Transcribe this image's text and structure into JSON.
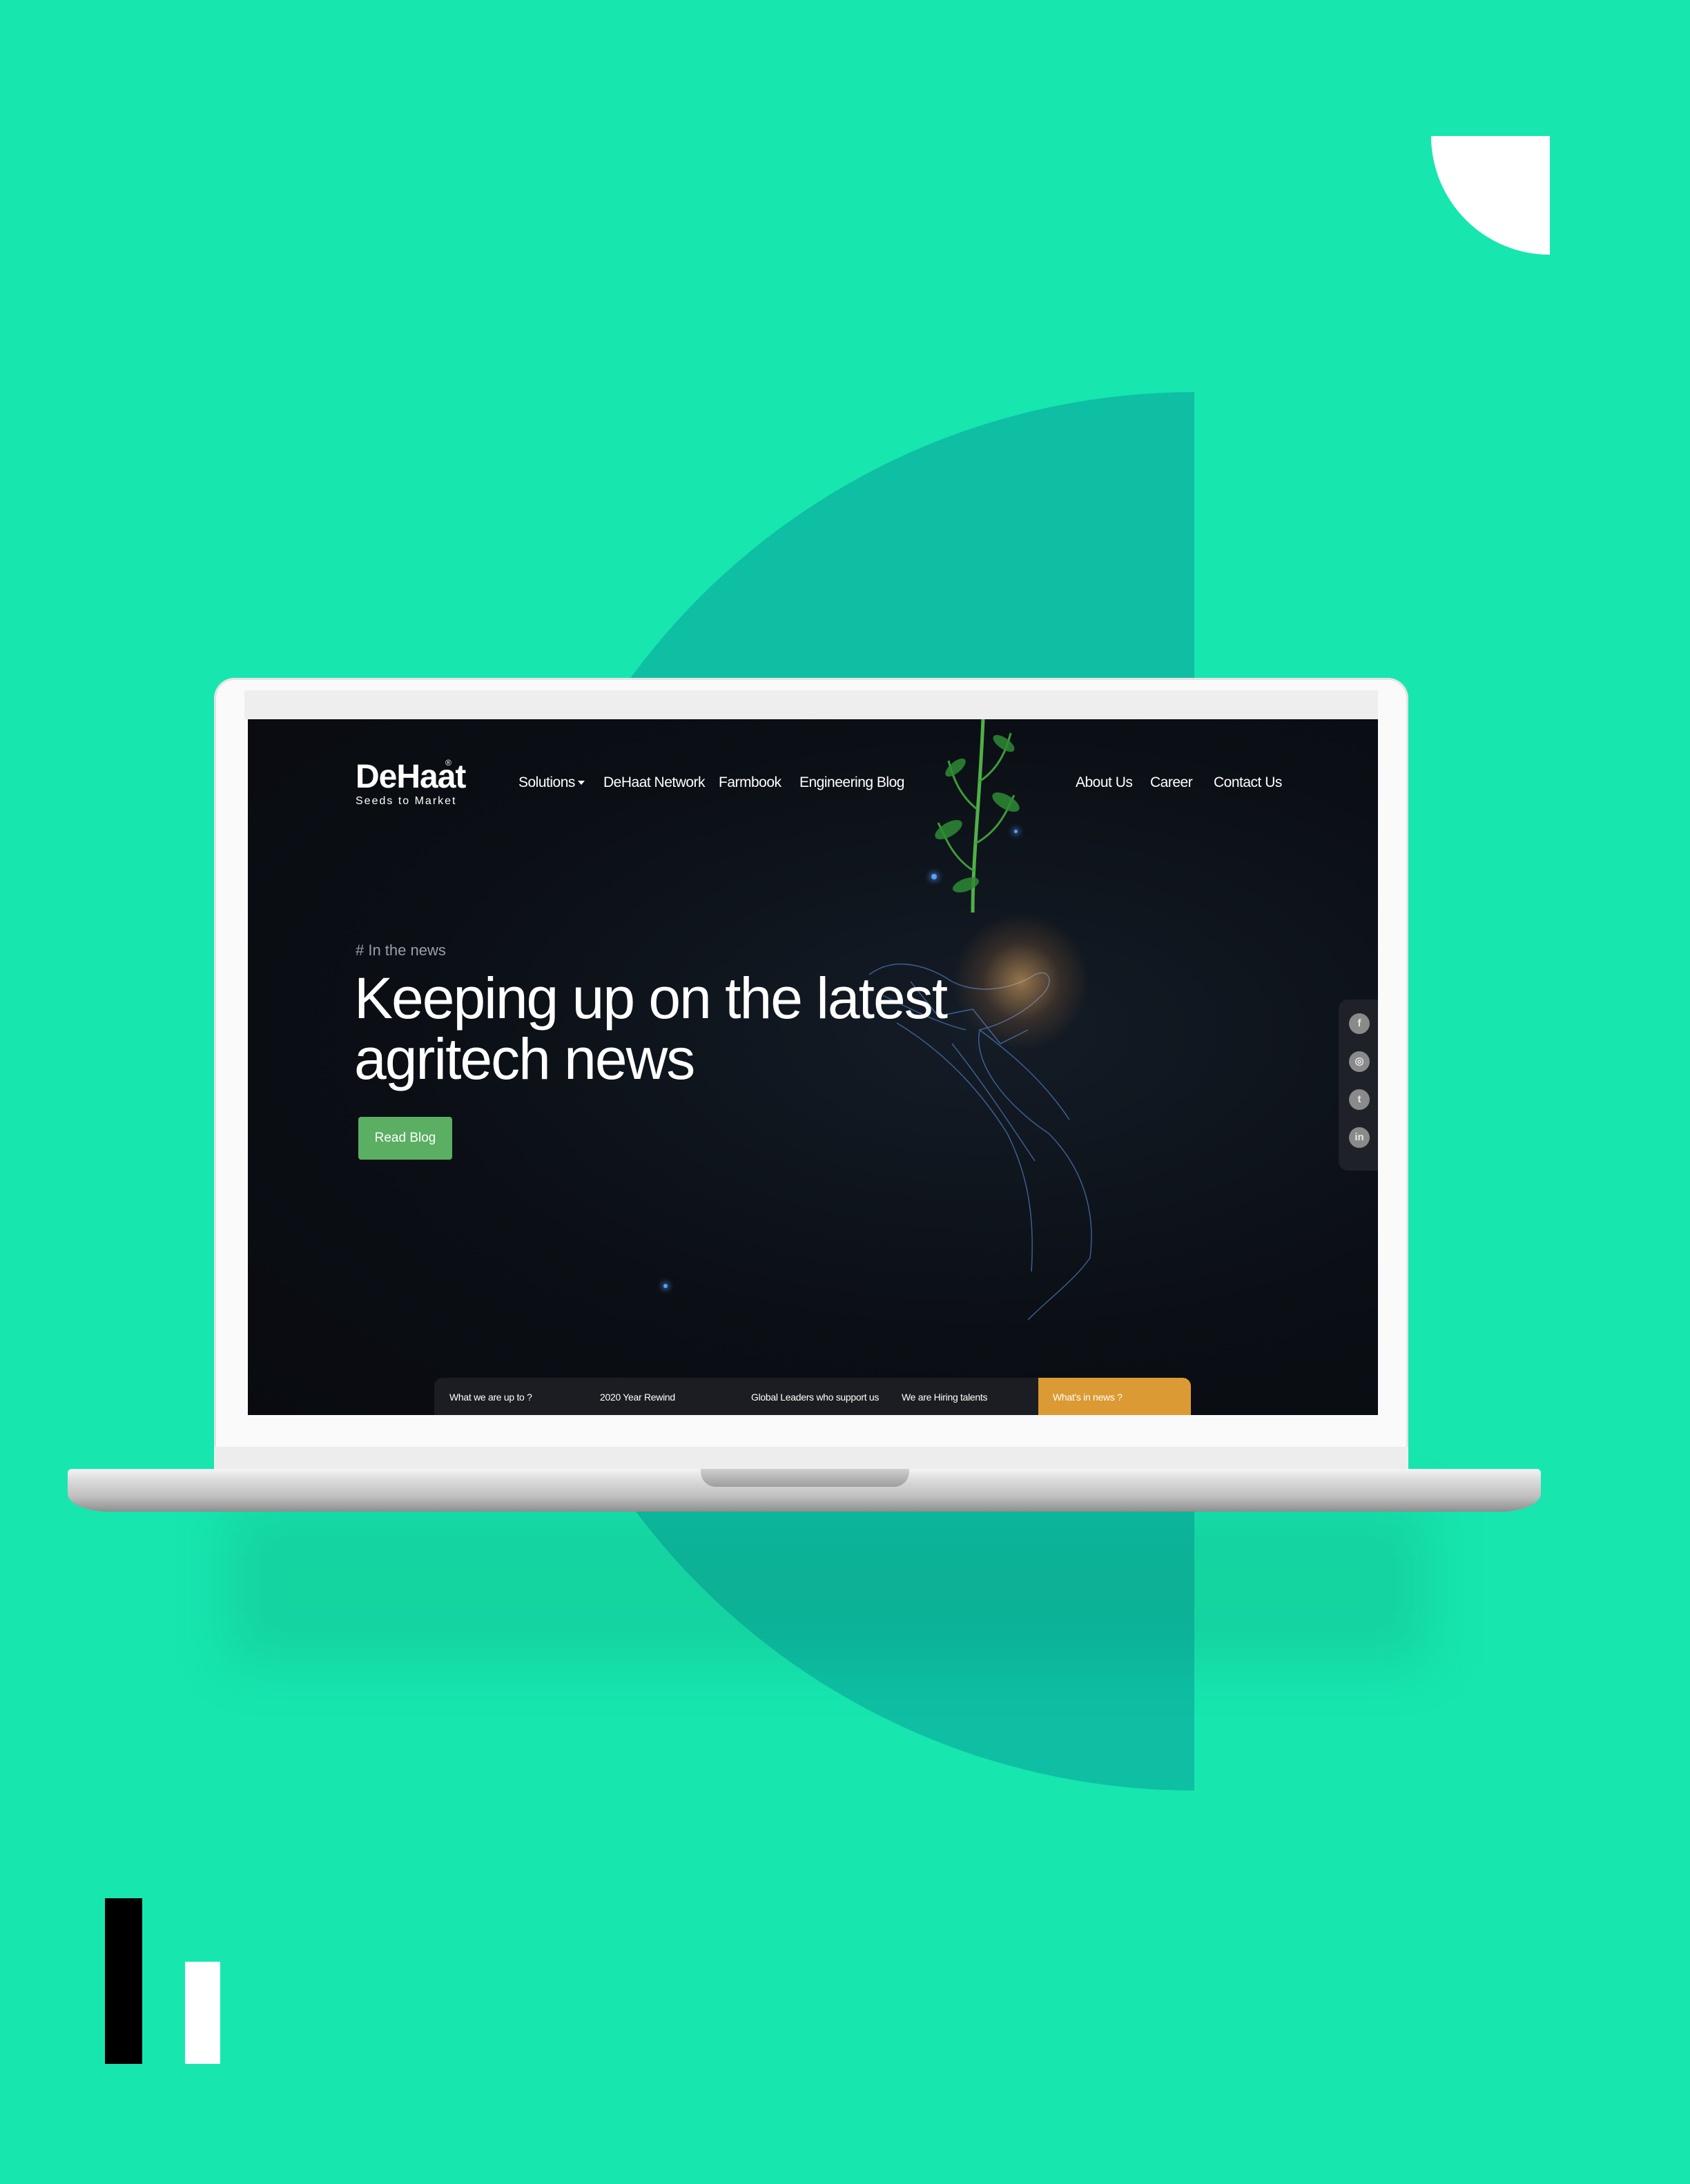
{
  "colors": {
    "background": "#17e6af",
    "half_disc": "#0ebfa3",
    "cta_button": "#5aaf62",
    "active_tab": "#db9a33",
    "screen_bg": "#0b0f15"
  },
  "site": {
    "logo_name": "DeHaat",
    "logo_registered": "®",
    "logo_tagline": "Seeds to Market"
  },
  "nav": {
    "left": [
      "Solutions",
      "DeHaat Network",
      "Farmbook",
      "Engineering Blog"
    ],
    "right": [
      "About Us",
      "Career",
      "Contact Us"
    ]
  },
  "hero": {
    "eyebrow": "# In the news",
    "title_line1": "Keeping up on the latest",
    "title_line2": "agritech news",
    "cta_label": "Read Blog"
  },
  "social": {
    "icons": [
      "facebook-icon",
      "instagram-icon",
      "twitter-icon",
      "linkedin-icon"
    ],
    "glyphs": [
      "f",
      "◎",
      "t",
      "in"
    ]
  },
  "bottom_tabs": [
    "What we are up to ?",
    "2020 Year Rewind",
    "Global Leaders who support us",
    "We are Hiring talents",
    "What's in news ?"
  ]
}
